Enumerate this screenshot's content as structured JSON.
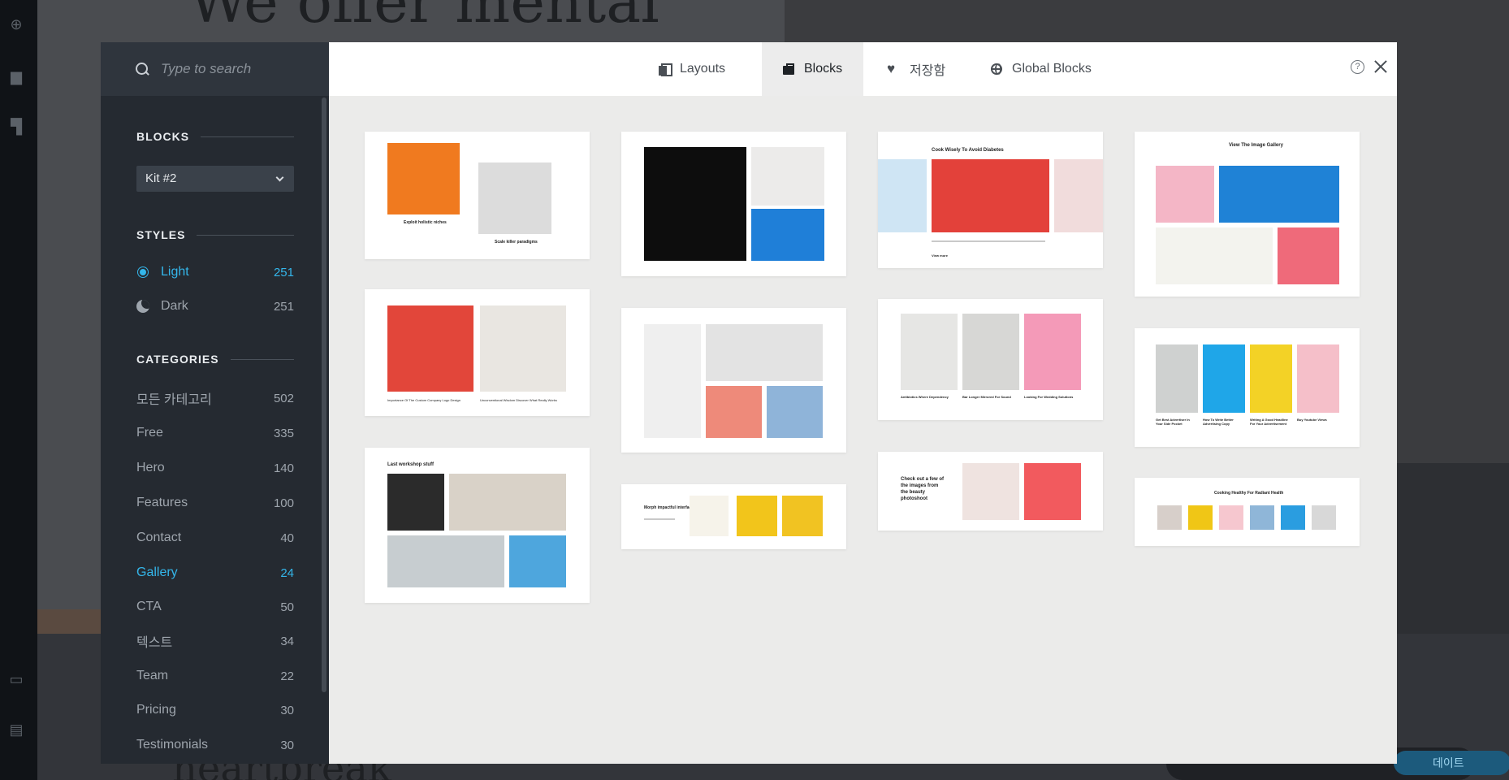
{
  "background": {
    "headline": "We offer mental",
    "footer_text": "heartbreak",
    "pill_label": "데이트"
  },
  "search": {
    "placeholder": "Type to search"
  },
  "sidebar": {
    "blocks_heading": "BLOCKS",
    "kit_selected": "Kit #2",
    "styles_heading": "STYLES",
    "styles": [
      {
        "label": "Light",
        "count": "251",
        "active": true
      },
      {
        "label": "Dark",
        "count": "251",
        "active": false
      }
    ],
    "categories_heading": "CATEGORIES",
    "categories": [
      {
        "label": "모든 카테고리",
        "count": "502"
      },
      {
        "label": "Free",
        "count": "335"
      },
      {
        "label": "Hero",
        "count": "140"
      },
      {
        "label": "Features",
        "count": "100"
      },
      {
        "label": "Contact",
        "count": "40"
      },
      {
        "label": "Gallery",
        "count": "24",
        "active": true
      },
      {
        "label": "CTA",
        "count": "50"
      },
      {
        "label": "텍스트",
        "count": "34"
      },
      {
        "label": "Team",
        "count": "22"
      },
      {
        "label": "Pricing",
        "count": "30"
      },
      {
        "label": "Testimonials",
        "count": "30"
      }
    ]
  },
  "tabs": [
    {
      "label": "Layouts",
      "icon": "layouts-icon"
    },
    {
      "label": "Blocks",
      "icon": "blocks-icon",
      "active": true
    },
    {
      "label": "저장함",
      "icon": "heart-icon"
    },
    {
      "label": "Global Blocks",
      "icon": "globe-icon"
    }
  ],
  "thumbnail_texts": {
    "c1a": "Exploit holistic niches",
    "c1b": "Scale killer paradigms",
    "c1c": "Importance Of The Custom Company Logo Design",
    "c1d": "Unconventional Wisdom Discover What Really Works",
    "c1e": "Last workshop stuff",
    "c2a": "Morph impactful interfaces",
    "c3a": "Cook Wisely To Avoid Diabetes",
    "c3b": "View more",
    "c3c": "Antibiotics Where Dependency",
    "c3d": "Bar Longer Mirrored For Sound",
    "c3e": "Looking For Wedding Solutions",
    "c3f": "Check out a few of the images from the beauty photoshoot",
    "c4a": "View The Image Gallery",
    "c4b": "Get Best Advertiser In Your Side Pocket",
    "c4c": "How To Write Better Advertising Copy",
    "c4d": "Writing A Good Headline For Your Advertisement",
    "c4e": "Buy Youtube Views",
    "c4f": "Cooking Healthy For Radiant Health"
  },
  "colors": {
    "accent": "#34b6ea",
    "sidebar_bg": "#252a31",
    "modal_bg": "#ebebea"
  }
}
